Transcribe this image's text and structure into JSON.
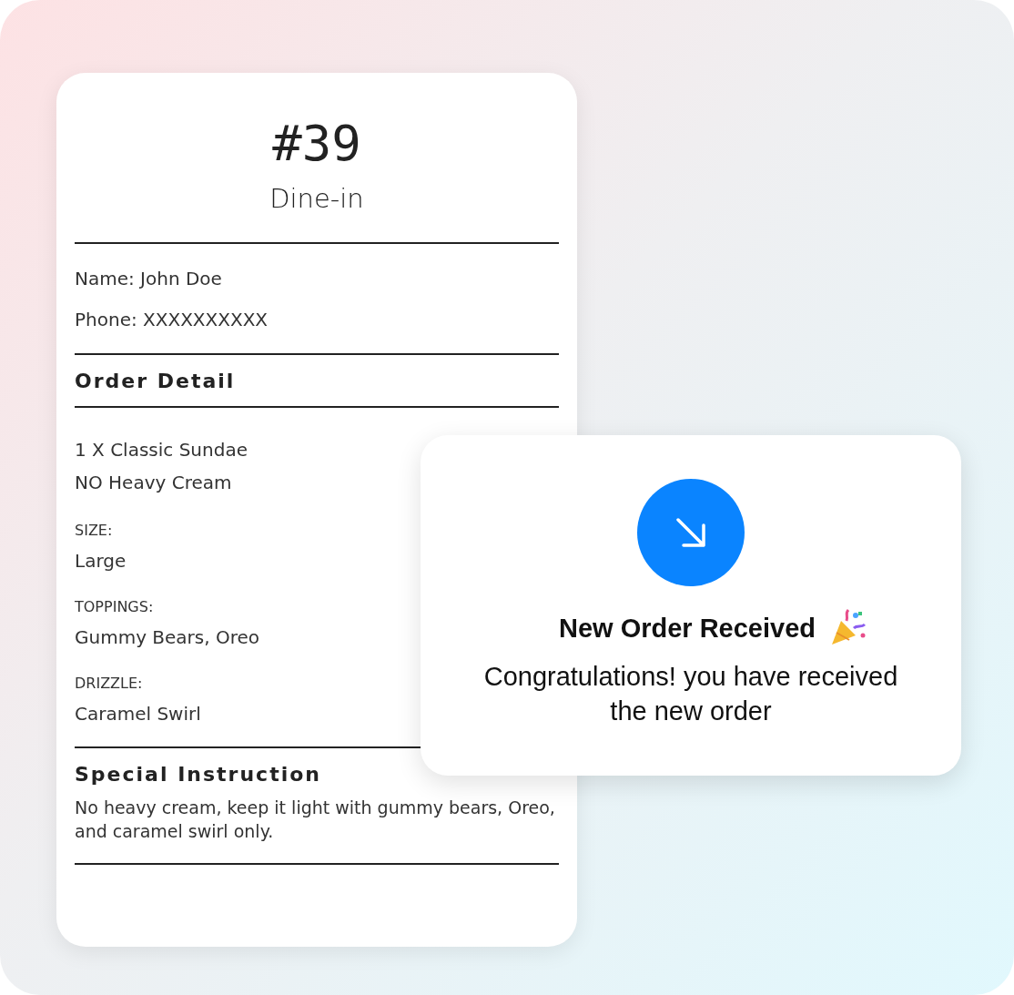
{
  "receipt": {
    "number": "#39",
    "order_type": "Dine-in",
    "customer_lines": [
      "Name: John Doe",
      "Phone: XXXXXXXXXX"
    ],
    "order_detail": {
      "heading": "Order Detail",
      "item": "1 X Classic Sundae",
      "note": "NO Heavy Cream",
      "options": [
        {
          "label": "SIZE:",
          "value": "Large"
        },
        {
          "label": "TOPPINGS:",
          "value": "Gummy Bears, Oreo"
        },
        {
          "label": "DRIZZLE:",
          "value": "Caramel Swirl"
        }
      ]
    },
    "special_instruction": {
      "heading": "Special Instruction",
      "text": "No heavy cream, keep it light with gummy bears, Oreo, and caramel swirl only."
    }
  },
  "notification": {
    "title": "New Order Received",
    "message": "Congratulations! you have received the new order"
  }
}
